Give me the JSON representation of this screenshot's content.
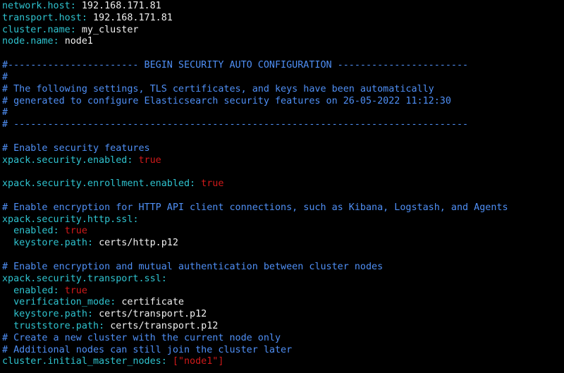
{
  "colors": {
    "background": "#000000",
    "key": "#2fc3cf",
    "value": "#f0f0f0",
    "literal": "#d01a1a",
    "comment": "#4f8ff5"
  },
  "lines": [
    {
      "type": "kv",
      "key": "network.host",
      "sep": ": ",
      "value": "192.168.171.81",
      "vclass": "v"
    },
    {
      "type": "kv",
      "key": "transport.host",
      "sep": ": ",
      "value": "192.168.171.81",
      "vclass": "v"
    },
    {
      "type": "kv",
      "key": "cluster.name",
      "sep": ": ",
      "value": "my_cluster",
      "vclass": "v"
    },
    {
      "type": "kv",
      "key": "node.name",
      "sep": ": ",
      "value": "node1",
      "vclass": "v"
    },
    {
      "type": "blank"
    },
    {
      "type": "comment",
      "text": "#----------------------- BEGIN SECURITY AUTO CONFIGURATION -----------------------"
    },
    {
      "type": "comment",
      "text": "#"
    },
    {
      "type": "comment",
      "text": "# The following settings, TLS certificates, and keys have been automatically"
    },
    {
      "type": "comment",
      "text": "# generated to configure Elasticsearch security features on 26-05-2022 11:12:30"
    },
    {
      "type": "comment",
      "text": "#"
    },
    {
      "type": "comment",
      "text": "# --------------------------------------------------------------------------------"
    },
    {
      "type": "blank"
    },
    {
      "type": "comment",
      "text": "# Enable security features"
    },
    {
      "type": "kv",
      "key": "xpack.security.enabled",
      "sep": ": ",
      "value": "true",
      "vclass": "r"
    },
    {
      "type": "blank"
    },
    {
      "type": "kv",
      "key": "xpack.security.enrollment.enabled",
      "sep": ": ",
      "value": "true",
      "vclass": "r"
    },
    {
      "type": "blank"
    },
    {
      "type": "comment",
      "text": "# Enable encryption for HTTP API client connections, such as Kibana, Logstash, and Agents"
    },
    {
      "type": "kv",
      "key": "xpack.security.http.ssl",
      "sep": ":",
      "value": "",
      "vclass": "v"
    },
    {
      "type": "kv",
      "key": "  enabled",
      "sep": ": ",
      "value": "true",
      "vclass": "r"
    },
    {
      "type": "kv",
      "key": "  keystore.path",
      "sep": ": ",
      "value": "certs/http.p12",
      "vclass": "v"
    },
    {
      "type": "blank"
    },
    {
      "type": "comment",
      "text": "# Enable encryption and mutual authentication between cluster nodes"
    },
    {
      "type": "kv",
      "key": "xpack.security.transport.ssl",
      "sep": ":",
      "value": "",
      "vclass": "v"
    },
    {
      "type": "kv",
      "key": "  enabled",
      "sep": ": ",
      "value": "true",
      "vclass": "r"
    },
    {
      "type": "kv",
      "key": "  verification_mode",
      "sep": ": ",
      "value": "certificate",
      "vclass": "v"
    },
    {
      "type": "kv",
      "key": "  keystore.path",
      "sep": ": ",
      "value": "certs/transport.p12",
      "vclass": "v"
    },
    {
      "type": "kv",
      "key": "  truststore.path",
      "sep": ": ",
      "value": "certs/transport.p12",
      "vclass": "v"
    },
    {
      "type": "comment",
      "text": "# Create a new cluster with the current node only"
    },
    {
      "type": "comment",
      "text": "# Additional nodes can still join the cluster later"
    },
    {
      "type": "kv",
      "key": "cluster.initial_master_nodes",
      "sep": ": ",
      "value": "[\"node1\"]",
      "vclass": "r"
    }
  ]
}
